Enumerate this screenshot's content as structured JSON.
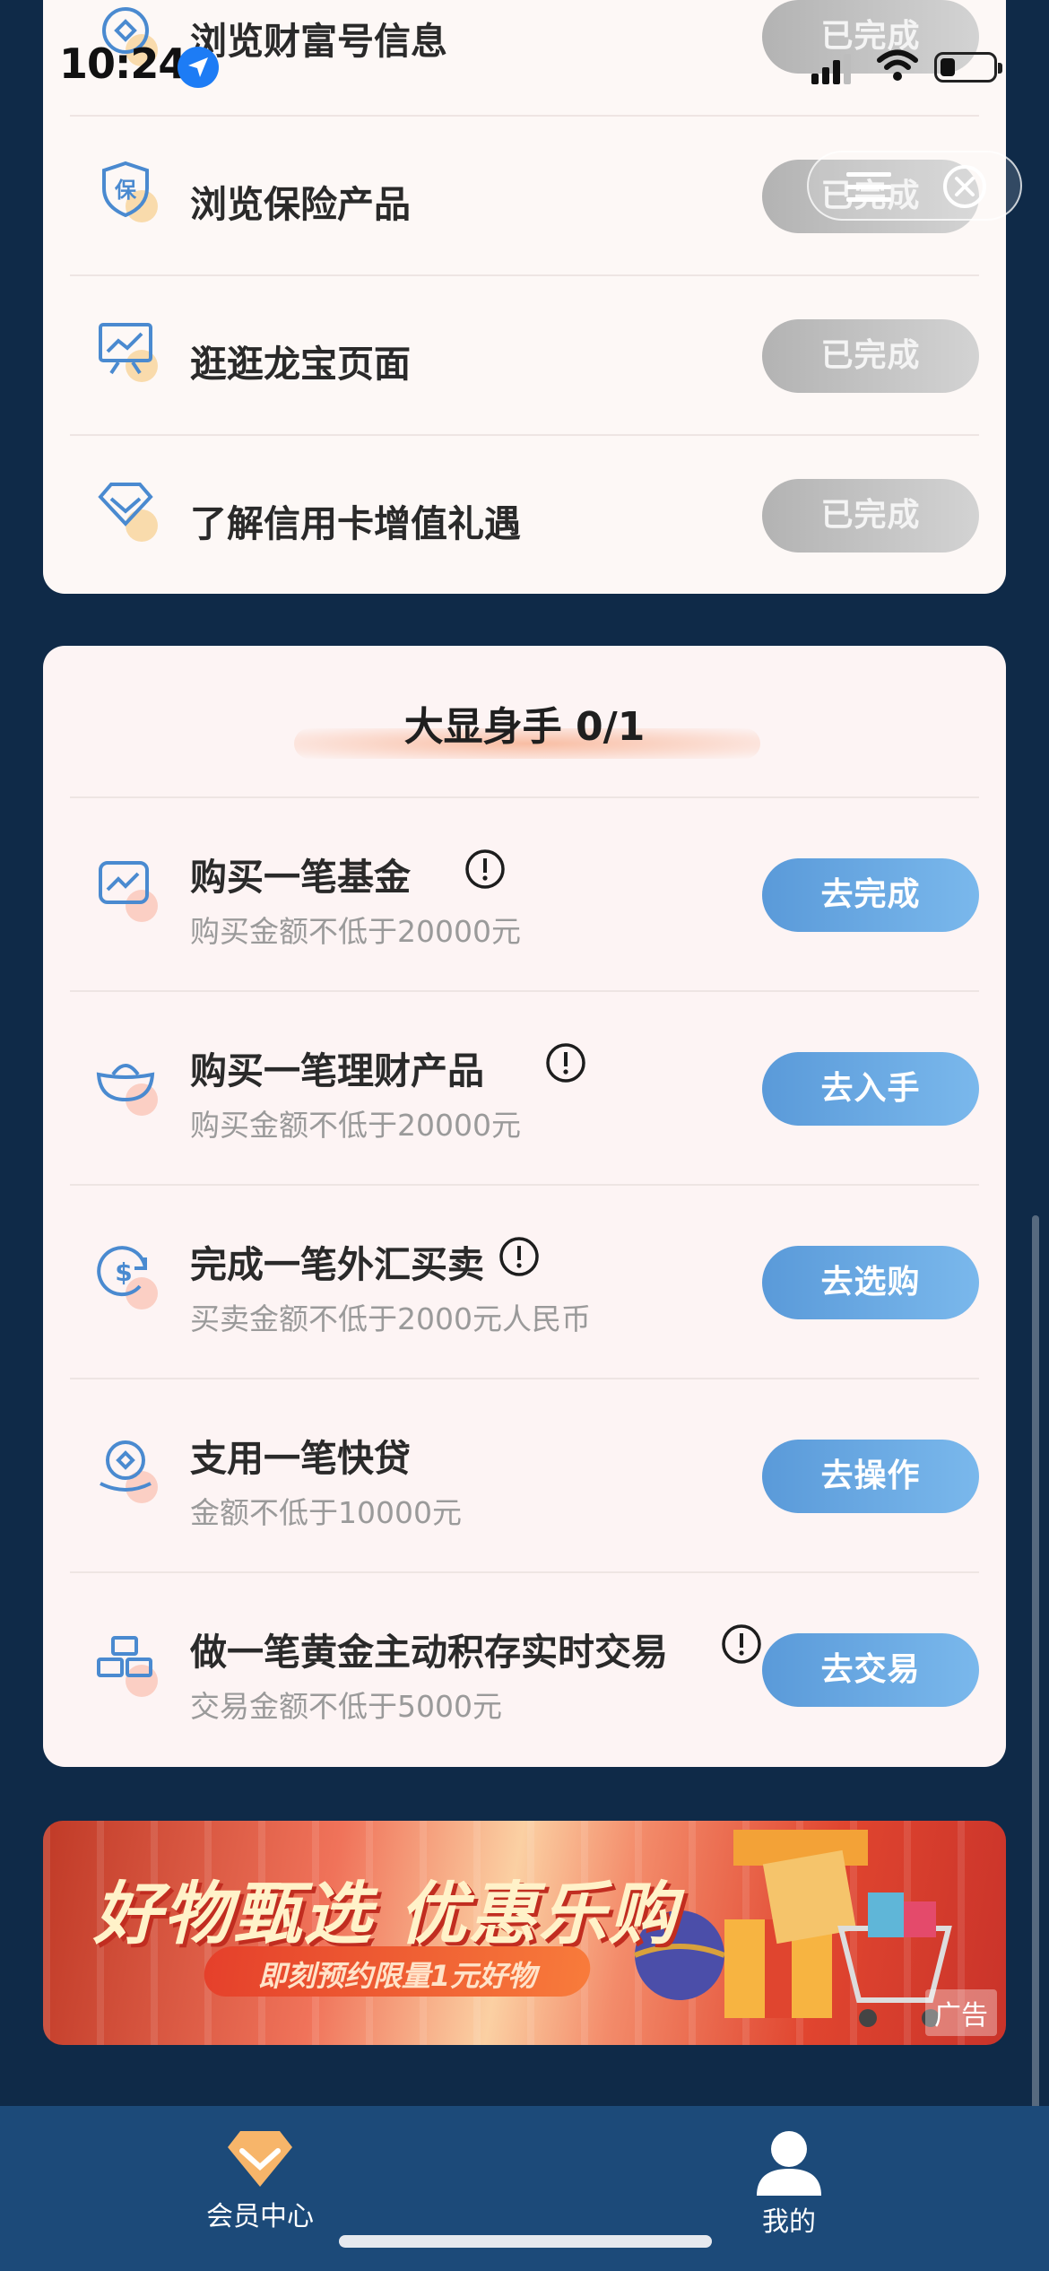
{
  "status_bar": {
    "time": "10:24"
  },
  "capsule": {
    "menu_icon": "menu-icon",
    "close_icon": "close-icon"
  },
  "daily_tasks": {
    "items": [
      {
        "title": "浏览财富号信息",
        "button": "已完成",
        "icon": "wealth-coin-icon"
      },
      {
        "title": "浏览保险产品",
        "button": "已完成",
        "icon": "insurance-shield-icon"
      },
      {
        "title": "逛逛龙宝页面",
        "button": "已完成",
        "icon": "presentation-board-icon"
      },
      {
        "title": "了解信用卡增值礼遇",
        "button": "已完成",
        "icon": "diamond-icon"
      }
    ]
  },
  "challenge": {
    "title": "大显身手 0/1",
    "items": [
      {
        "title": "购买一笔基金",
        "subtitle": "购买金额不低于20000元",
        "button": "去完成",
        "icon": "fund-chart-icon",
        "has_info": true
      },
      {
        "title": "购买一笔理财产品",
        "subtitle": "购买金额不低于20000元",
        "button": "去入手",
        "icon": "ingot-icon",
        "has_info": true
      },
      {
        "title": "完成一笔外汇买卖",
        "subtitle": "买卖金额不低于2000元人民币",
        "button": "去选购",
        "icon": "currency-exchange-icon",
        "has_info": true
      },
      {
        "title": "支用一笔快贷",
        "subtitle": "金额不低于10000元",
        "button": "去操作",
        "icon": "loan-coin-icon",
        "has_info": false
      },
      {
        "title": "做一笔黄金主动积存实时交易",
        "subtitle": "交易金额不低于5000元",
        "button": "去交易",
        "icon": "gold-bars-icon",
        "has_info": true
      }
    ]
  },
  "banner": {
    "title": "好物甄选 优惠乐购",
    "subtitle": "即刻预约限量1元好物",
    "ad_label": "广告"
  },
  "tabbar": {
    "tabs": [
      {
        "label": "会员中心",
        "icon": "member-diamond-icon",
        "active": true
      },
      {
        "label": "我的",
        "icon": "user-icon",
        "active": false
      }
    ]
  },
  "colors": {
    "page_bg": "#0f2a48",
    "card_bg": "#fdf8f6",
    "button_active": "#5a9ad9",
    "button_done": "#b3b3b3",
    "tabbar_bg": "#1c4a79"
  }
}
